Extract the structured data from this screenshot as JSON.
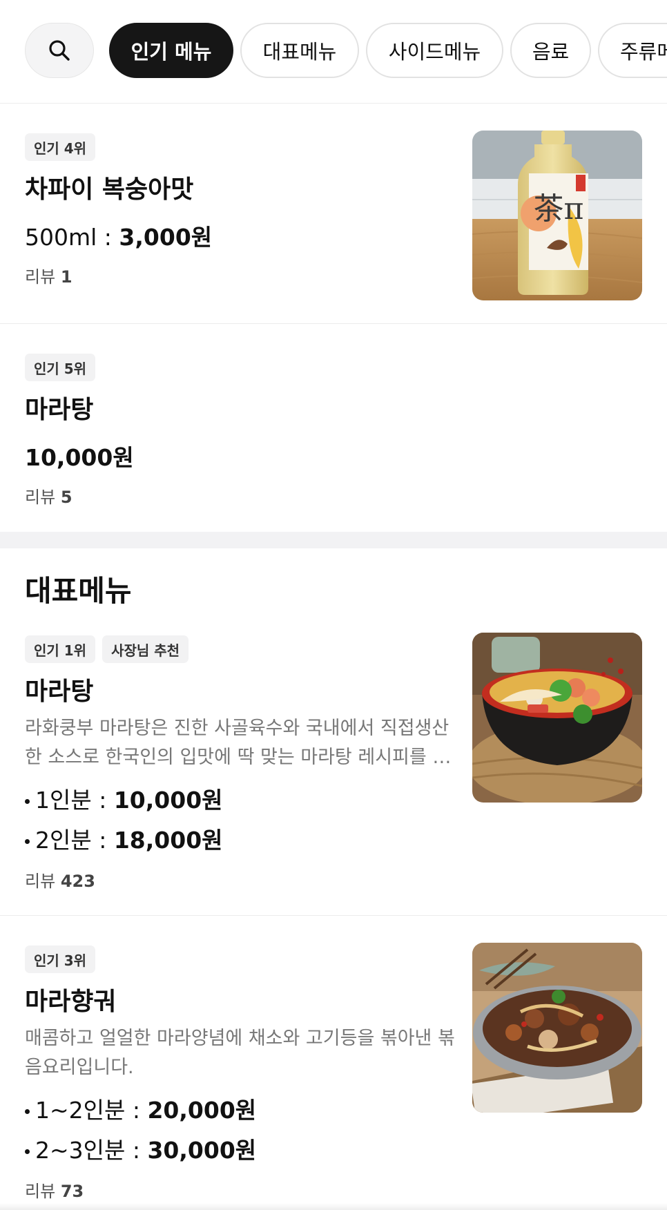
{
  "tabs": {
    "search_icon": "search-icon",
    "items": [
      {
        "label": "인기 메뉴",
        "active": true
      },
      {
        "label": "대표메뉴",
        "active": false
      },
      {
        "label": "사이드메뉴",
        "active": false
      },
      {
        "label": "음료",
        "active": false
      },
      {
        "label": "주류메뉴",
        "active": false
      }
    ]
  },
  "popular": [
    {
      "badge": "인기 4위",
      "name": "차파이 복숭아맛",
      "size": "500ml : ",
      "price": "3,000원",
      "review_label": "리뷰",
      "review_count": "1"
    },
    {
      "badge": "인기 5위",
      "name": "마라탕",
      "price": "10,000원",
      "review_label": "리뷰",
      "review_count": "5"
    }
  ],
  "section": {
    "title": "대표메뉴",
    "items": [
      {
        "badges": [
          "인기 1위",
          "사장님 추천"
        ],
        "name": "마라탕",
        "description": "라화쿵부 마라탕은 진한 사골육수와 국내에서 직접생산한 소스로 한국인의 입맛에 딱 맞는 마라탕 레시피를 완성했습니다.",
        "options": [
          {
            "label": "1인분 : ",
            "price": "10,000원"
          },
          {
            "label": "2인분 : ",
            "price": "18,000원"
          }
        ],
        "review_label": "리뷰",
        "review_count": "423"
      },
      {
        "badges": [
          "인기 3위"
        ],
        "name": "마라향궈",
        "description": "매콤하고 얼얼한 마라양념에 채소와 고기등을 볶아낸 볶음요리입니다.",
        "options": [
          {
            "label": "1~2인분 : ",
            "price": "20,000원"
          },
          {
            "label": "2~3인분 : ",
            "price": "30,000원"
          }
        ],
        "review_label": "리뷰",
        "review_count": "73"
      }
    ]
  },
  "image_label": {
    "bottle_logo_text": "茶π"
  },
  "colors": {
    "active_chip": "#161616",
    "chip_border": "#e2e2e2",
    "badge_bg": "#f2f2f3",
    "description": "#777777"
  }
}
